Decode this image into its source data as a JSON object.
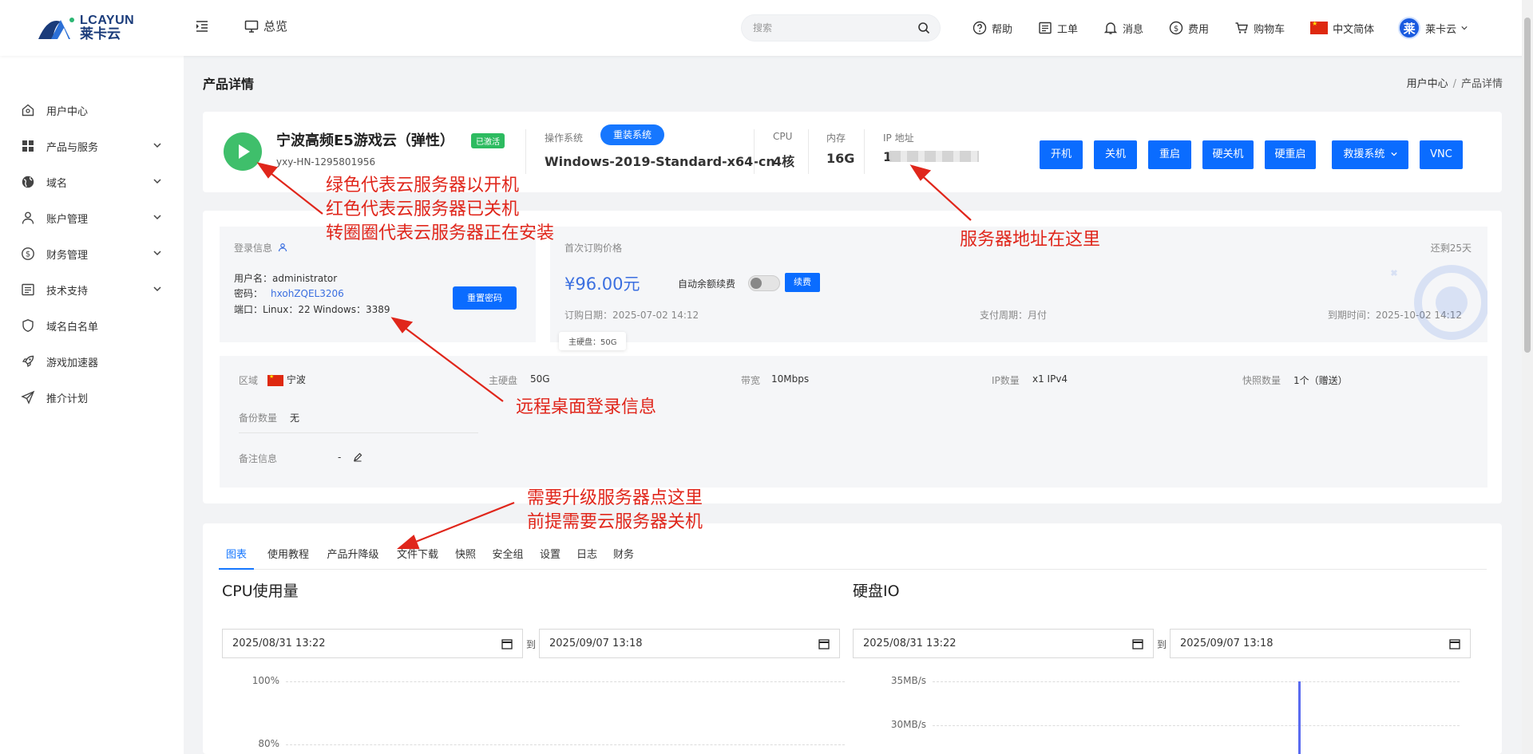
{
  "brand": {
    "name_en": "LCAYUN",
    "name_cn": "莱卡云"
  },
  "topbar": {
    "overview": "总览",
    "search_placeholder": "搜索",
    "links": [
      "帮助",
      "工单",
      "消息",
      "费用",
      "购物车"
    ],
    "language": "中文简体",
    "user_initial": "莱",
    "user_name": "莱卡云"
  },
  "sidebar": {
    "items": [
      {
        "label": "用户中心",
        "icon": "home-icon",
        "expandable": false
      },
      {
        "label": "产品与服务",
        "icon": "grid-icon",
        "expandable": true
      },
      {
        "label": "域名",
        "icon": "globe-icon",
        "expandable": true
      },
      {
        "label": "账户管理",
        "icon": "user-icon",
        "expandable": true
      },
      {
        "label": "财务管理",
        "icon": "money-icon",
        "expandable": true
      },
      {
        "label": "技术支持",
        "icon": "ticket-icon",
        "expandable": true
      },
      {
        "label": "域名白名单",
        "icon": "shield-icon",
        "expandable": false
      },
      {
        "label": "游戏加速器",
        "icon": "rocket-icon",
        "expandable": false
      },
      {
        "label": "推介计划",
        "icon": "send-icon",
        "expandable": false
      }
    ]
  },
  "page": {
    "title": "产品详情",
    "breadcrumb": [
      "用户中心",
      "产品详情"
    ]
  },
  "product": {
    "status_color": "#3fbf6b",
    "name": "宁波高频E5游戏云（弹性）",
    "badge": "已激活",
    "id": "yxy-HN-1295801956",
    "os_label": "操作系统",
    "reinstall_label": "重装系统",
    "os_value": "Windows-2019-Standard-x64-cn",
    "cpu_label": "CPU",
    "cpu_value": "4核",
    "mem_label": "内存",
    "mem_value": "16G",
    "ip_label": "IP 地址",
    "ip_visible": "1",
    "actions": [
      "开机",
      "关机",
      "重启",
      "硬关机",
      "硬重启",
      "救援系统",
      "VNC"
    ]
  },
  "login": {
    "title": "登录信息",
    "username_label": "用户名：",
    "username": "administrator",
    "password_label": "密码：",
    "password": "hxohZQEL3206",
    "port_label": "端口：",
    "port": "Linux：22 Windows：3389",
    "reset_label": "重置密码"
  },
  "billing": {
    "first_price_label": "首次订购价格",
    "remaining": "还剩25天",
    "price": "¥96.00元",
    "auto_renew_label": "自动余额续费",
    "auto_renew_on": false,
    "renew_label": "续费",
    "order_date": "订购日期：2025-07-02 14:12",
    "pay_cycle": "支付周期：月付",
    "expire": "到期时间：2025-10-02 14:12",
    "tooltip": "主硬盘：50G"
  },
  "specs": {
    "region_label": "区域",
    "region": "宁波",
    "disk_label": "主硬盘",
    "disk": "50G",
    "bandwidth_label": "带宽",
    "bandwidth": "10Mbps",
    "ip_count_label": "IP数量",
    "ip_count": "x1 IPv4",
    "snapshot_label": "快照数量",
    "snapshot": "1个（赠送）",
    "backup_label": "备份数量",
    "backup": "无",
    "note_label": "备注信息",
    "note": "-"
  },
  "tabs": [
    "图表",
    "使用教程",
    "产品升降级",
    "文件下载",
    "快照",
    "安全组",
    "设置",
    "日志",
    "财务"
  ],
  "charts": {
    "cpu": {
      "title": "CPU使用量",
      "from": "2025/08/31  13:22",
      "to_label": "到",
      "to": "2025/09/07  13:18",
      "y_ticks": [
        "100%",
        "80%"
      ]
    },
    "disk": {
      "title": "硬盘IO",
      "from": "2025/08/31  13:22",
      "to_label": "到",
      "to": "2025/09/07  13:18",
      "y_ticks": [
        "35MB/s",
        "30MB/s"
      ]
    }
  },
  "annotations": {
    "status": [
      "绿色代表云服务器以开机",
      "红色代表云服务器已关机",
      "转圈圈代表云服务器正在安装"
    ],
    "ip": "服务器地址在这里",
    "login": "远程桌面登录信息",
    "upgrade": [
      "需要升级服务器点这里",
      "前提需要云服务器关机"
    ]
  },
  "colors": {
    "primary": "#0a6cff",
    "annotation": "#e0261b",
    "active_green": "#2dbb60"
  }
}
